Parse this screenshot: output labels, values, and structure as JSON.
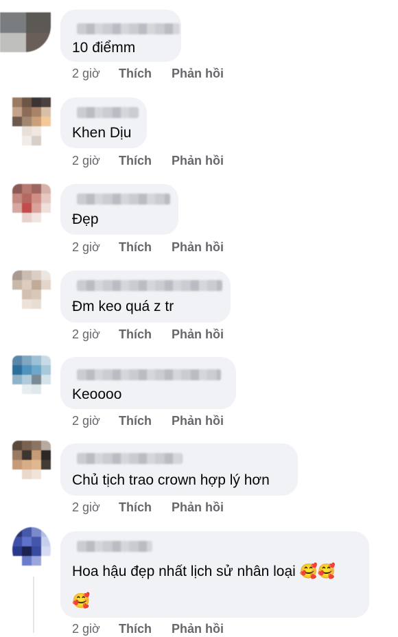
{
  "comments": [
    {
      "text": "10 điểmm",
      "time": "2 giờ",
      "like": "Thích",
      "reply": "Phản hồi"
    },
    {
      "text": "Khen Dịu",
      "time": "2 giờ",
      "like": "Thích",
      "reply": "Phản hồi"
    },
    {
      "text": "Đẹp",
      "time": "2 giờ",
      "like": "Thích",
      "reply": "Phản hồi"
    },
    {
      "text": "Đm keo quá z tr",
      "time": "2 giờ",
      "like": "Thích",
      "reply": "Phản hồi"
    },
    {
      "text": "Keoooo",
      "time": "2 giờ",
      "like": "Thích",
      "reply": "Phản hồi"
    },
    {
      "text": "Chủ tịch trao crown hợp lý hơn",
      "time": "2 giờ",
      "like": "Thích",
      "reply": "Phản hồi"
    },
    {
      "text": "Hoa hậu đẹp nhất lịch sử nhân loại 🥰🥰",
      "text2": "🥰",
      "time": "2 giờ",
      "like": "Thích",
      "reply": "Phản hồi"
    }
  ]
}
